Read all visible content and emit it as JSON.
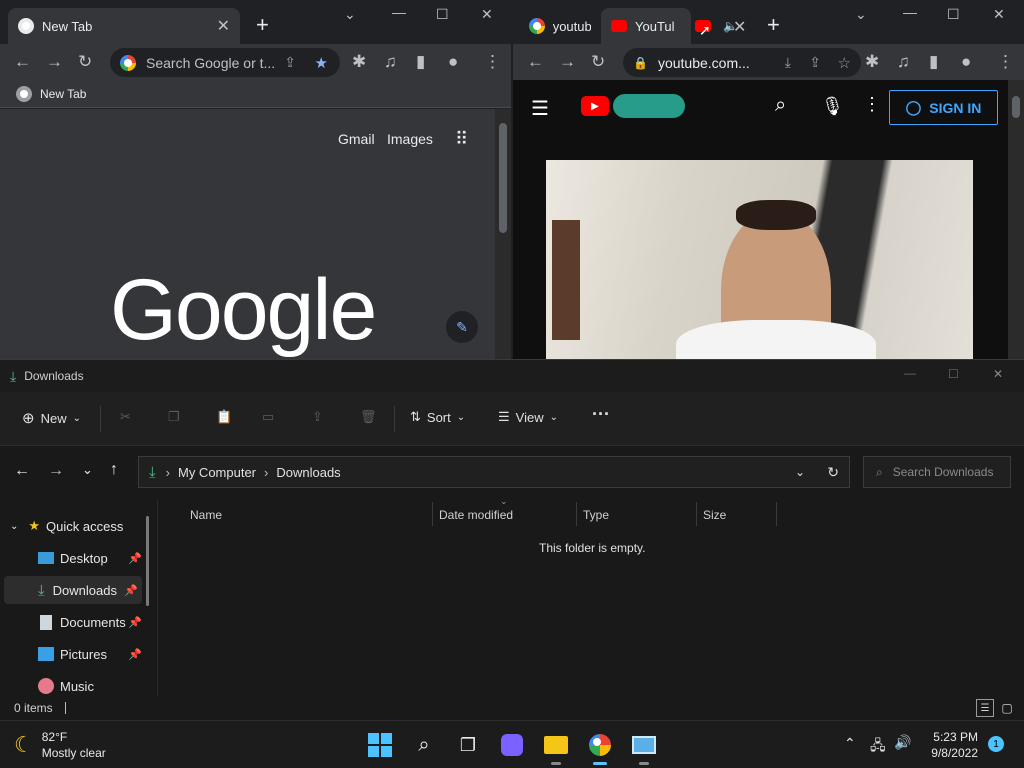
{
  "chrome_left": {
    "tab_title": "New Tab",
    "omnibox_placeholder": "Search Google or t...",
    "bookmark_label": "New Tab",
    "ntp_links": [
      "Gmail",
      "Images"
    ],
    "logo_text": "Google"
  },
  "chrome_right": {
    "tabs": [
      "youtub",
      "YouTul",
      ""
    ],
    "url": "youtube.com...",
    "sign_in_label": "SIGN IN"
  },
  "explorer": {
    "title": "Downloads",
    "cmd_new": "New",
    "cmd_sort": "Sort",
    "cmd_view": "View",
    "cmd_more": "···",
    "breadcrumb": [
      "My Computer",
      "Downloads"
    ],
    "search_placeholder": "Search Downloads",
    "columns": [
      "Name",
      "Date modified",
      "Type",
      "Size"
    ],
    "empty_message": "This folder is empty.",
    "nav_items": [
      {
        "label": "Quick access",
        "icon": "star-icon"
      },
      {
        "label": "Desktop",
        "icon": "desktop-icon"
      },
      {
        "label": "Downloads",
        "icon": "download-icon"
      },
      {
        "label": "Documents",
        "icon": "document-icon"
      },
      {
        "label": "Pictures",
        "icon": "pictures-icon"
      },
      {
        "label": "Music",
        "icon": "music-icon"
      }
    ],
    "status_items": "0 items"
  },
  "taskbar": {
    "weather_temp": "82°F",
    "weather_desc": "Mostly clear",
    "time": "5:23 PM",
    "date": "9/8/2022",
    "notification_count": "1"
  },
  "colors": {
    "youtube_red": "#ff0000",
    "accent_blue": "#3ea6ff",
    "chrome_blue": "#8ab4f8",
    "download_green": "#4cc38a"
  }
}
